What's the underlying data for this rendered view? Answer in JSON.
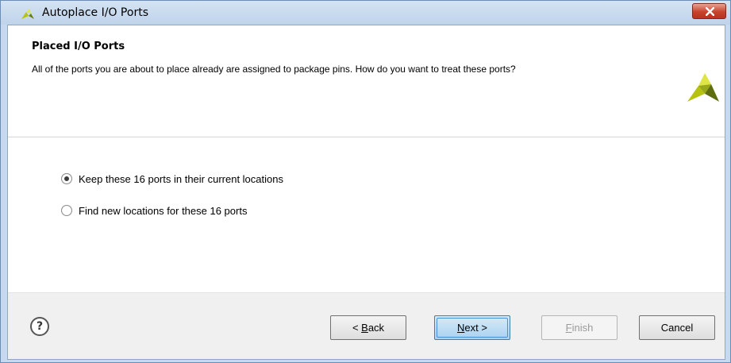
{
  "window": {
    "title": "Autoplace I/O Ports",
    "close_icon": "close-icon"
  },
  "header": {
    "title": "Placed I/O Ports",
    "description": "All of the ports you are about to place already are assigned to package pins. How do you want to treat these ports?",
    "logo_icon": "vivado-logo-icon"
  },
  "options": {
    "keep": {
      "label": "Keep these 16 ports in their current locations",
      "selected": true
    },
    "find": {
      "label": "Find new locations for these 16 ports",
      "selected": false
    }
  },
  "footer": {
    "help_label": "?",
    "back_label_prefix": "< ",
    "back_label_mnemonic": "B",
    "back_label_rest": "ack",
    "next_label_mnemonic": "N",
    "next_label_rest": "ext >",
    "finish_label_mnemonic": "F",
    "finish_label_rest": "inish",
    "cancel_label": "Cancel"
  },
  "colors": {
    "logo_yellow": "#c9d31f",
    "logo_dark": "#5b6b12",
    "close_red": "#c7432c",
    "next_blue": "#a9d1f0"
  }
}
